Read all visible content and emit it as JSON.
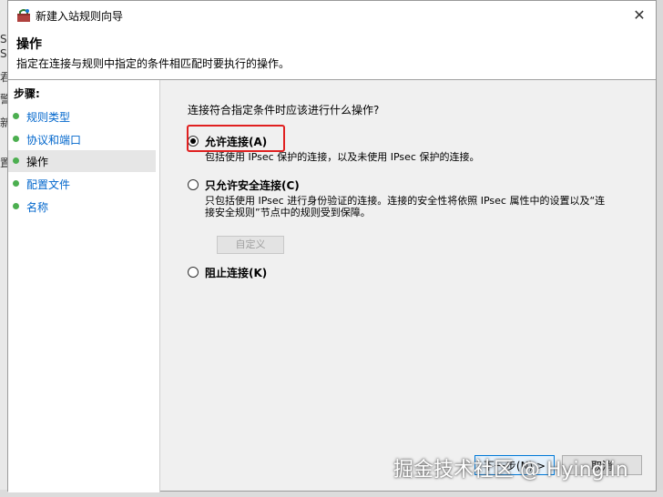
{
  "background": {
    "left_chars": [
      "S",
      "S",
      "君",
      "警",
      "新",
      "置"
    ]
  },
  "dialog": {
    "title": "新建入站规则向导",
    "close_glyph": "✕"
  },
  "header": {
    "title": "操作",
    "description": "指定在连接与规则中指定的条件相匹配时要执行的操作。"
  },
  "steps": {
    "heading": "步骤:",
    "items": [
      {
        "label": "规则类型",
        "current": false
      },
      {
        "label": "协议和端口",
        "current": false
      },
      {
        "label": "操作",
        "current": true
      },
      {
        "label": "配置文件",
        "current": false
      },
      {
        "label": "名称",
        "current": false
      }
    ]
  },
  "content": {
    "question": "连接符合指定条件时应该进行什么操作?",
    "options": [
      {
        "label": "允许连接(A)",
        "checked": true,
        "description": "包括使用 IPsec 保护的连接，以及未使用 IPsec 保护的连接。"
      },
      {
        "label": "只允许安全连接(C)",
        "checked": false,
        "description": "只包括使用 IPsec 进行身份验证的连接。连接的安全性将依照 IPsec 属性中的设置以及“连接安全规则”节点中的规则受到保障。"
      },
      {
        "label": "阻止连接(K)",
        "checked": false
      }
    ],
    "customize_label": "自定义"
  },
  "buttons": {
    "next_label": "下一步(N) >",
    "cancel_label": "取消"
  },
  "watermark": "掘金技术社区 @ Hyinglin",
  "colors": {
    "link": "#0066cc",
    "status_dot": "#4caf50",
    "highlight": "#e02020"
  }
}
